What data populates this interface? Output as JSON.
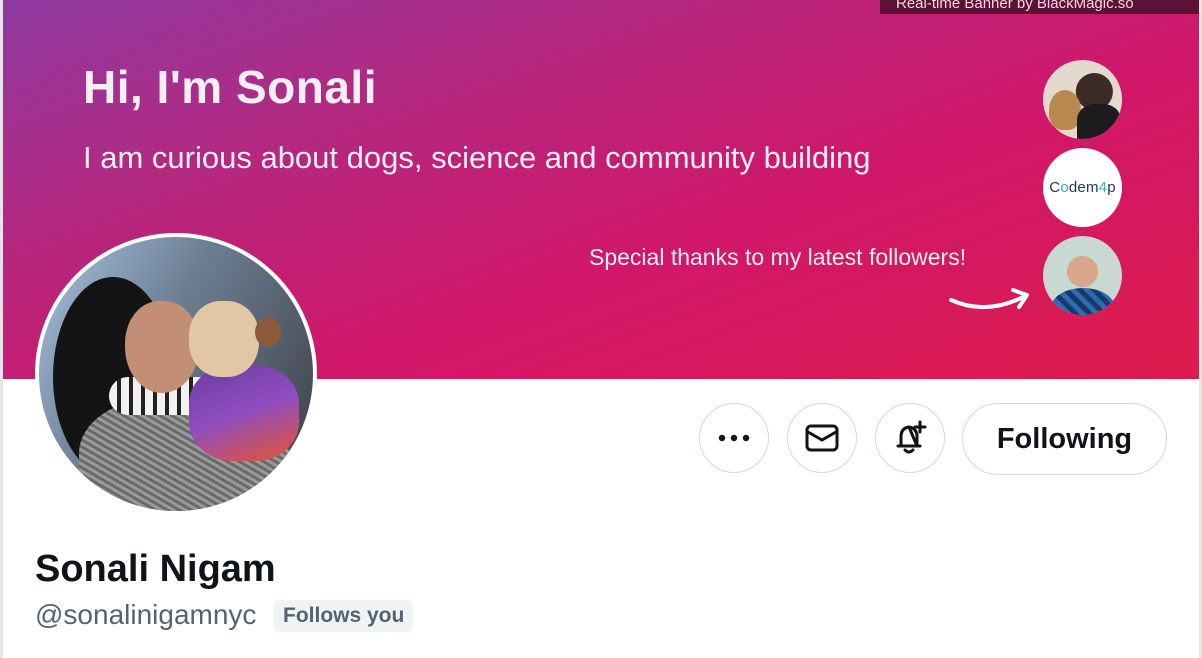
{
  "banner": {
    "credit": "Real-time Banner by BlackMagic.so",
    "greeting": "Hi, I'm Sonali",
    "tagline": "I am curious about dogs, science and community building",
    "thanks": "Special thanks to my latest followers!",
    "followers": [
      {
        "name": "follower-1"
      },
      {
        "name": "follower-2",
        "logo_text_a": "C",
        "logo_text_o": "o",
        "logo_text_b": "dem",
        "logo_text_4": "4",
        "logo_text_p": "p"
      },
      {
        "name": "follower-3"
      }
    ],
    "colors": {
      "gradient_start": "#8e3aa0",
      "gradient_mid": "#d0176a",
      "gradient_end": "#de1b4c"
    }
  },
  "profile": {
    "display_name": "Sonali Nigam",
    "handle": "@sonalinigamnyc",
    "follows_you": "Follows you"
  },
  "actions": {
    "more_icon": "more-icon",
    "message_icon": "envelope-icon",
    "notify_icon": "bell-plus-icon",
    "following_label": "Following"
  }
}
